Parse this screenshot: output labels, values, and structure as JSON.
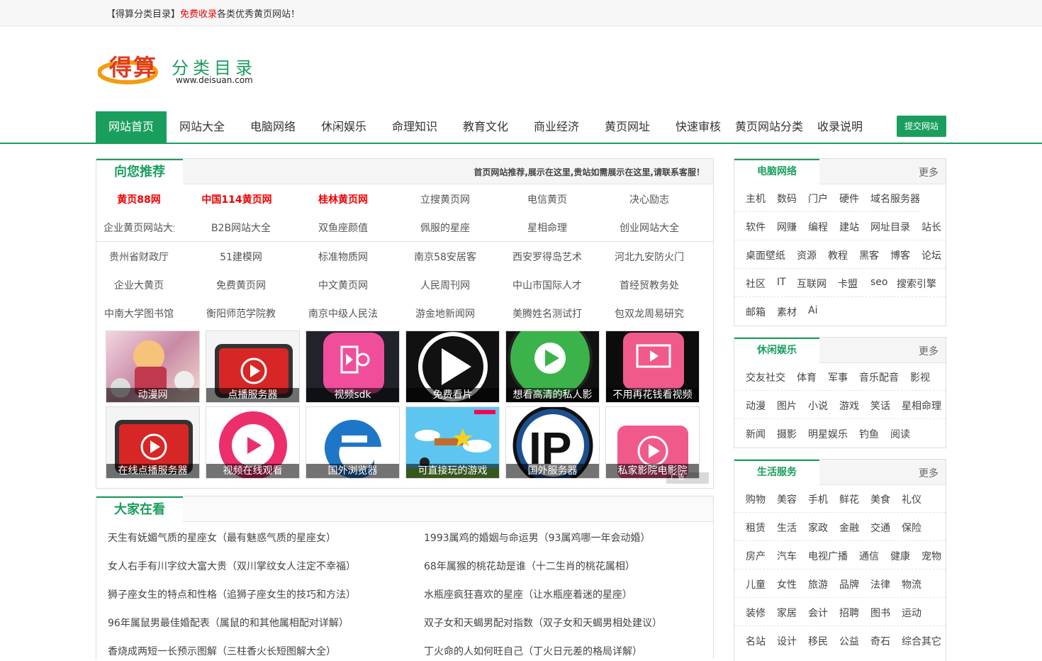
{
  "topbar": {
    "pre": "【得算分类目录】",
    "red": "免费收录",
    "post": "各类优秀黄页网站！"
  },
  "logo": {
    "cn_big": "得算",
    "cn_small": "分类目录",
    "url": "www.deisuan.com"
  },
  "nav": {
    "items": [
      "网站首页",
      "网站大全",
      "电脑网络",
      "休闲娱乐",
      "命理知识",
      "教育文化",
      "商业经济",
      "黄页网址",
      "快速审核",
      "黄页网站分类",
      "收录说明"
    ],
    "submit": "提交网站"
  },
  "recommend": {
    "title": "向您推荐",
    "notice": "首页网站推荐,展示在这里,贵站如需展示在这里,请联系客服！",
    "row1": [
      "黄页88网",
      "中国114黄页网",
      "桂林黄页网",
      "立搜黄页网",
      "电信黄页",
      "决心励志"
    ],
    "row2": [
      "企业黄页网站大全",
      "B2B网站大全",
      "双鱼座颜值",
      "佩服的星座",
      "星相命理",
      "创业网站大全"
    ],
    "row3": [
      "贵州省财政厅",
      "51建模网",
      "标准物质网",
      "南京58安居客",
      "西安罗得岛艺术",
      "河北九安防火门"
    ],
    "row4": [
      "企业大黄页",
      "免费黄页网",
      "中文黄页网",
      "人民周刊网",
      "中山市国际人才",
      "首经贸教务处"
    ],
    "row5": [
      "中南大学图书馆",
      "衡阳师范学院教",
      "南京中级人民法",
      "游金地新闻网",
      "美腾姓名测试打",
      "包双龙周易研究"
    ],
    "thumbs1": [
      "动漫网",
      "点播服务器",
      "视频sdk",
      "免费看片",
      "想看高清的私人影",
      "不用再花钱看视频"
    ],
    "thumbs2": [
      "在线点播服务器",
      "视频在线观看",
      "国外浏览器",
      "可直接玩的游戏",
      "国外服务器",
      "私家影院电影院"
    ],
    "adtag": "广告"
  },
  "hot": {
    "title": "大家在看",
    "left": [
      "天生有妩媚气质的星座女（最有魅惑气质的星座女）",
      "女人右手有川字纹大富大贵（双川掌纹女人注定不幸福）",
      "狮子座女生的特点和性格（追狮子座女生的技巧和方法）",
      "96年属鼠男最佳婚配表（属鼠的和其他属相配对详解）",
      "香烧成两短一长预示图解（三柱香火长短图解大全）"
    ],
    "right": [
      "1993属鸡的婚姻与命运男（93属鸡哪一年会动婚）",
      "68年属猴的桃花劫是谁（十二生肖的桃花属相）",
      "水瓶座疯狂喜欢的星座（让水瓶座着迷的星座）",
      "双子女和天蝎男配对指数（双子女和天蝎男相处建议）",
      "丁火命的人如何旺自己（丁火日元差的格局详解）"
    ]
  },
  "side": {
    "more": "更多",
    "computer": {
      "title": "电脑网络",
      "rows": [
        [
          "主机",
          "数码",
          "门户",
          "硬件",
          "域名服务器"
        ],
        [
          "软件",
          "网赚",
          "编程",
          "建站",
          "网址目录",
          "站长"
        ],
        [
          "桌面壁纸",
          "资源",
          "教程",
          "黑客",
          "博客",
          "论坛"
        ],
        [
          "社区",
          "IT",
          "互联网",
          "卡盟",
          "seo",
          "搜索引擎"
        ],
        [
          "邮箱",
          "素材",
          "Ai"
        ]
      ]
    },
    "leisure": {
      "title": "休闲娱乐",
      "rows": [
        [
          "交友社交",
          "体育",
          "军事",
          "音乐配音",
          "影视"
        ],
        [
          "动漫",
          "图片",
          "小说",
          "游戏",
          "笑话",
          "星相命理"
        ],
        [
          "新闻",
          "摄影",
          "明星娱乐",
          "钓鱼",
          "阅读"
        ]
      ]
    },
    "life": {
      "title": "生活服务",
      "rows": [
        [
          "购物",
          "美容",
          "手机",
          "鲜花",
          "美食",
          "礼仪"
        ],
        [
          "租赁",
          "生活",
          "家政",
          "金融",
          "交通",
          "保险"
        ],
        [
          "房产",
          "汽车",
          "电视广播",
          "通信",
          "健康",
          "宠物"
        ],
        [
          "儿童",
          "女性",
          "旅游",
          "品牌",
          "法律",
          "物流"
        ],
        [
          "装修",
          "家居",
          "会计",
          "招聘",
          "图书",
          "运动"
        ],
        [
          "名站",
          "设计",
          "移民",
          "公益",
          "奇石",
          "综合其它"
        ]
      ]
    }
  }
}
